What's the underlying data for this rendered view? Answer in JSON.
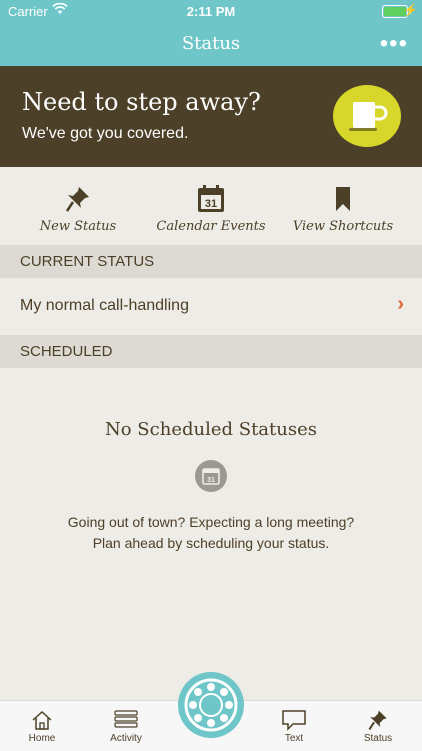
{
  "status_bar": {
    "carrier": "Carrier",
    "time": "2:11 PM"
  },
  "nav": {
    "title": "Status",
    "more_icon": "more-dots-icon"
  },
  "banner": {
    "headline": "Need to step away?",
    "subtext": "We've got you covered."
  },
  "actions": [
    {
      "label": "New Status",
      "icon": "pushpin-icon"
    },
    {
      "label": "Calendar Events",
      "icon": "calendar-icon",
      "day": "31"
    },
    {
      "label": "View Shortcuts",
      "icon": "bookmark-icon"
    }
  ],
  "current_status": {
    "header": "CURRENT STATUS",
    "value": "My normal call-handling",
    "chevron": "›"
  },
  "scheduled": {
    "header": "SCHEDULED",
    "empty_title": "No Scheduled Statuses",
    "empty_icon_day": "31",
    "empty_line1": "Going out of town? Expecting a long meeting?",
    "empty_line2": "Plan ahead by scheduling your status."
  },
  "tabs": [
    {
      "label": "Home",
      "icon": "house-icon"
    },
    {
      "label": "Activity",
      "icon": "list-icon"
    },
    {
      "label": "",
      "icon": "rotary-dial-icon"
    },
    {
      "label": "Text",
      "icon": "speech-bubble-icon"
    },
    {
      "label": "Status",
      "icon": "pushpin-icon",
      "selected": true
    }
  ],
  "colors": {
    "teal": "#6fc6c9",
    "brown": "#4d4029",
    "yellow": "#d7d62a",
    "accent": "#e0632f",
    "background": "#eeece7"
  }
}
